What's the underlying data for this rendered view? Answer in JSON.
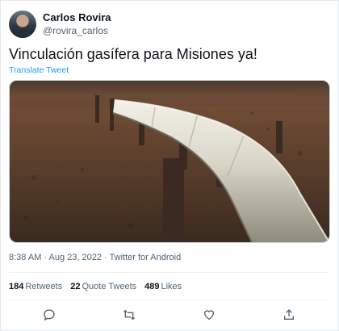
{
  "author": {
    "display_name": "Carlos Rovira",
    "handle": "@rovira_carlos"
  },
  "tweet": {
    "text": "Vinculación gasífera para Misiones ya!",
    "translate_label": "Translate Tweet",
    "image_alt": "gas pipeline across desert landscape",
    "meta": "8:38 AM · Aug 23, 2022 · Twitter for Android"
  },
  "stats": {
    "retweets_count": "184",
    "retweets_label": "Retweets",
    "quotes_count": "22",
    "quotes_label": "Quote Tweets",
    "likes_count": "489",
    "likes_label": "Likes"
  },
  "actions": [
    "reply-icon",
    "retweet-icon",
    "like-icon",
    "share-icon"
  ],
  "colors": {
    "link": "#1d9bf0",
    "muted": "#536471",
    "text": "#0f1419"
  }
}
